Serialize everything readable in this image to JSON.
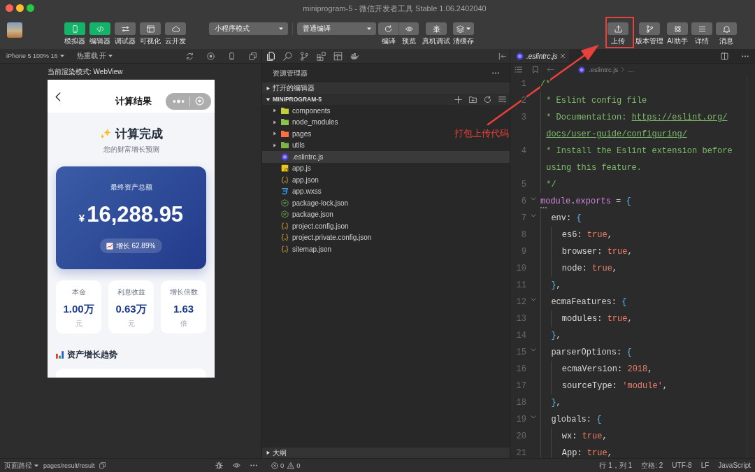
{
  "window": {
    "title": "miniprogram-5 - 微信开发者工具 Stable 1.06.2402040"
  },
  "toolbar": {
    "view_buttons": [
      {
        "label": "模拟器",
        "on": true
      },
      {
        "label": "编辑器",
        "on": true
      },
      {
        "label": "调试器",
        "on": false
      },
      {
        "label": "可视化",
        "on": false
      },
      {
        "label": "云开发",
        "on": false
      }
    ],
    "mode_select": {
      "value": "小程序模式"
    },
    "compile_select": {
      "value": "普通编译"
    },
    "compile_buttons": [
      {
        "label": "编译"
      },
      {
        "label": "预览"
      },
      {
        "label": "真机调试"
      },
      {
        "label": "清缓存"
      }
    ],
    "right_buttons": [
      {
        "label": "上传"
      },
      {
        "label": "版本管理"
      },
      {
        "label": "AI助手"
      },
      {
        "label": "详情"
      },
      {
        "label": "消息"
      }
    ]
  },
  "simulator": {
    "device": "iPhone 5 100% 16",
    "hot_reload": "热重载 开",
    "render_mode": "当前渲染模式: WebView",
    "page": {
      "nav_title": "计算结果",
      "heading": "计算完成",
      "subheading": "您的财富增长预测",
      "total": {
        "label": "最终资产总额",
        "currency": "¥",
        "amount": "16,288.95",
        "growth": "增长 62.89%"
      },
      "stats": [
        {
          "label": "本金",
          "value": "1.00万",
          "unit": "元"
        },
        {
          "label": "利息收益",
          "value": "0.63万",
          "unit": "元"
        },
        {
          "label": "增长倍数",
          "value": "1.63",
          "unit": "倍"
        }
      ],
      "section_title": "资产增长趋势"
    }
  },
  "explorer": {
    "title": "资源管理器",
    "open_editors": {
      "label": "打开的编辑器",
      "expanded": false
    },
    "project": {
      "label": "MINIPROGRAM-5",
      "expanded": true,
      "children": [
        {
          "name": "components",
          "kind": "folder",
          "color": "#c3cf38",
          "expanded": false,
          "selected": false
        },
        {
          "name": "node_modules",
          "kind": "folder",
          "color": "#8bc34a",
          "expanded": false,
          "selected": false
        },
        {
          "name": "pages",
          "kind": "folder",
          "color": "#ff6e40",
          "expanded": false,
          "selected": false
        },
        {
          "name": "utils",
          "kind": "folder",
          "color": "#7cb342",
          "expanded": false,
          "selected": false
        },
        {
          "name": ".eslintrc.js",
          "kind": "eslint",
          "selected": true
        },
        {
          "name": "app.js",
          "kind": "js",
          "selected": false
        },
        {
          "name": "app.json",
          "kind": "json",
          "selected": false
        },
        {
          "name": "app.wxss",
          "kind": "css",
          "selected": false
        },
        {
          "name": "package-lock.json",
          "kind": "node",
          "selected": false
        },
        {
          "name": "package.json",
          "kind": "node",
          "selected": false
        },
        {
          "name": "project.config.json",
          "kind": "json",
          "selected": false
        },
        {
          "name": "project.private.config.json",
          "kind": "json",
          "selected": false
        },
        {
          "name": "sitemap.json",
          "kind": "json",
          "selected": false
        }
      ]
    },
    "outline": {
      "label": "大纲",
      "expanded": false
    }
  },
  "editor": {
    "tabs": [
      {
        "label": ".eslintrc.js",
        "selected": true
      }
    ],
    "breadcrumb": [
      ".eslintrc.js",
      "…"
    ],
    "lines": [
      {
        "number": "1",
        "foldable": false,
        "hint": false,
        "rows": [
          [
            {
              "kind": "comment",
              "text": "/*"
            }
          ]
        ]
      },
      {
        "number": "2",
        "foldable": false,
        "hint": false,
        "rows": [
          [
            {
              "kind": "indent",
              "text": " "
            },
            {
              "kind": "comment",
              "text": "* Eslint config file"
            }
          ]
        ]
      },
      {
        "number": "3",
        "foldable": false,
        "hint": false,
        "rows": [
          [
            {
              "kind": "indent",
              "text": " "
            },
            {
              "kind": "comment",
              "text": "* Documentation: "
            },
            {
              "kind": "link",
              "text": "https://eslint.org/"
            }
          ],
          [
            {
              "kind": "indent",
              "text": " "
            },
            {
              "kind": "link",
              "text": "docs/user-guide/configuring/"
            }
          ]
        ]
      },
      {
        "number": "4",
        "foldable": false,
        "hint": false,
        "rows": [
          [
            {
              "kind": "indent",
              "text": " "
            },
            {
              "kind": "comment",
              "text": "* Install the Eslint extension before"
            }
          ],
          [
            {
              "kind": "indent",
              "text": " "
            },
            {
              "kind": "comment",
              "text": "using this feature."
            }
          ]
        ]
      },
      {
        "number": "5",
        "foldable": false,
        "hint": false,
        "rows": [
          [
            {
              "kind": "indent",
              "text": " "
            },
            {
              "kind": "comment",
              "text": "*/"
            }
          ]
        ]
      },
      {
        "number": "6",
        "foldable": true,
        "hint": true,
        "rows": [
          [
            {
              "kind": "keyword",
              "text": "module"
            },
            {
              "kind": "punct",
              "text": "."
            },
            {
              "kind": "keyword",
              "text": "exports"
            },
            {
              "kind": "punct",
              "text": " = "
            },
            {
              "kind": "brace",
              "text": "{"
            }
          ]
        ]
      },
      {
        "number": "7",
        "foldable": true,
        "hint": false,
        "rows": [
          [
            {
              "kind": "indent",
              "text": "  "
            },
            {
              "kind": "plain",
              "text": "env"
            },
            {
              "kind": "punct",
              "text": ": "
            },
            {
              "kind": "brace",
              "text": "{"
            }
          ]
        ]
      },
      {
        "number": "8",
        "foldable": false,
        "hint": false,
        "rows": [
          [
            {
              "kind": "indent",
              "text": "  "
            },
            {
              "kind": "indent",
              "text": "  "
            },
            {
              "kind": "plain",
              "text": "es6"
            },
            {
              "kind": "punct",
              "text": ": "
            },
            {
              "kind": "literal",
              "text": "true"
            },
            {
              "kind": "punct",
              "text": ","
            }
          ]
        ]
      },
      {
        "number": "9",
        "foldable": false,
        "hint": false,
        "rows": [
          [
            {
              "kind": "indent",
              "text": "  "
            },
            {
              "kind": "indent",
              "text": "  "
            },
            {
              "kind": "plain",
              "text": "browser"
            },
            {
              "kind": "punct",
              "text": ": "
            },
            {
              "kind": "literal",
              "text": "true"
            },
            {
              "kind": "punct",
              "text": ","
            }
          ]
        ]
      },
      {
        "number": "10",
        "foldable": false,
        "hint": false,
        "rows": [
          [
            {
              "kind": "indent",
              "text": "  "
            },
            {
              "kind": "indent",
              "text": "  "
            },
            {
              "kind": "plain",
              "text": "node"
            },
            {
              "kind": "punct",
              "text": ": "
            },
            {
              "kind": "literal",
              "text": "true"
            },
            {
              "kind": "punct",
              "text": ","
            }
          ]
        ]
      },
      {
        "number": "11",
        "foldable": false,
        "hint": false,
        "rows": [
          [
            {
              "kind": "indent",
              "text": "  "
            },
            {
              "kind": "brace",
              "text": "}"
            },
            {
              "kind": "punct",
              "text": ","
            }
          ]
        ]
      },
      {
        "number": "12",
        "foldable": true,
        "hint": false,
        "rows": [
          [
            {
              "kind": "indent",
              "text": "  "
            },
            {
              "kind": "plain",
              "text": "ecmaFeatures"
            },
            {
              "kind": "punct",
              "text": ": "
            },
            {
              "kind": "brace",
              "text": "{"
            }
          ]
        ]
      },
      {
        "number": "13",
        "foldable": false,
        "hint": false,
        "rows": [
          [
            {
              "kind": "indent",
              "text": "  "
            },
            {
              "kind": "indent",
              "text": "  "
            },
            {
              "kind": "plain",
              "text": "modules"
            },
            {
              "kind": "punct",
              "text": ": "
            },
            {
              "kind": "literal",
              "text": "true"
            },
            {
              "kind": "punct",
              "text": ","
            }
          ]
        ]
      },
      {
        "number": "14",
        "foldable": false,
        "hint": false,
        "rows": [
          [
            {
              "kind": "indent",
              "text": "  "
            },
            {
              "kind": "brace",
              "text": "}"
            },
            {
              "kind": "punct",
              "text": ","
            }
          ]
        ]
      },
      {
        "number": "15",
        "foldable": true,
        "hint": false,
        "rows": [
          [
            {
              "kind": "indent",
              "text": "  "
            },
            {
              "kind": "plain",
              "text": "parserOptions"
            },
            {
              "kind": "punct",
              "text": ": "
            },
            {
              "kind": "brace",
              "text": "{"
            }
          ]
        ]
      },
      {
        "number": "16",
        "foldable": false,
        "hint": false,
        "rows": [
          [
            {
              "kind": "indent",
              "text": "  "
            },
            {
              "kind": "indent",
              "text": "  "
            },
            {
              "kind": "plain",
              "text": "ecmaVersion"
            },
            {
              "kind": "punct",
              "text": ": "
            },
            {
              "kind": "literal",
              "text": "2018"
            },
            {
              "kind": "punct",
              "text": ","
            }
          ]
        ]
      },
      {
        "number": "17",
        "foldable": false,
        "hint": false,
        "rows": [
          [
            {
              "kind": "indent",
              "text": "  "
            },
            {
              "kind": "indent",
              "text": "  "
            },
            {
              "kind": "plain",
              "text": "sourceType"
            },
            {
              "kind": "punct",
              "text": ": "
            },
            {
              "kind": "literal",
              "text": "'module'"
            },
            {
              "kind": "punct",
              "text": ","
            }
          ]
        ]
      },
      {
        "number": "18",
        "foldable": false,
        "hint": false,
        "rows": [
          [
            {
              "kind": "indent",
              "text": "  "
            },
            {
              "kind": "brace",
              "text": "}"
            },
            {
              "kind": "punct",
              "text": ","
            }
          ]
        ]
      },
      {
        "number": "19",
        "foldable": true,
        "hint": false,
        "rows": [
          [
            {
              "kind": "indent",
              "text": "  "
            },
            {
              "kind": "plain",
              "text": "globals"
            },
            {
              "kind": "punct",
              "text": ": "
            },
            {
              "kind": "brace",
              "text": "{"
            }
          ]
        ]
      },
      {
        "number": "20",
        "foldable": false,
        "hint": false,
        "rows": [
          [
            {
              "kind": "indent",
              "text": "  "
            },
            {
              "kind": "indent",
              "text": "  "
            },
            {
              "kind": "plain",
              "text": "wx"
            },
            {
              "kind": "punct",
              "text": ": "
            },
            {
              "kind": "literal",
              "text": "true"
            },
            {
              "kind": "punct",
              "text": ","
            }
          ]
        ]
      },
      {
        "number": "21",
        "foldable": false,
        "hint": false,
        "rows": [
          [
            {
              "kind": "indent",
              "text": "  "
            },
            {
              "kind": "indent",
              "text": "  "
            },
            {
              "kind": "plain",
              "text": "App"
            },
            {
              "kind": "punct",
              "text": ": "
            },
            {
              "kind": "literal",
              "text": "true"
            },
            {
              "kind": "punct",
              "text": ","
            }
          ]
        ]
      }
    ]
  },
  "annotation": {
    "label": "打包上传代码"
  },
  "status_bar": {
    "path_label": "页面路径",
    "path": "pages/result/result",
    "errors": "0",
    "warnings": "0",
    "items": [
      "行 1，列 1",
      "空格: 2",
      "UTF-8",
      "LF",
      "JavaScript"
    ]
  }
}
